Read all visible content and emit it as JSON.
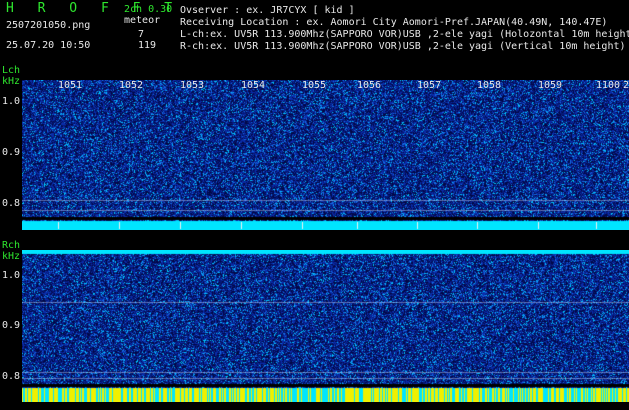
{
  "header": {
    "app_name": "H R O F F T",
    "mode": "2ch 0.30",
    "filename": "2507201050.png",
    "datetime": "25.07.20 10:50",
    "meteor_label": "meteor",
    "meteor_lch": "7",
    "meteor_rch": "119"
  },
  "info": {
    "observer": "Ovserver          : ex. JR7CYX [ kid ]",
    "location": "Receiving Location : ex. Aomori City Aomori-Pref.JAPAN(40.49N, 140.47E)",
    "lch": "L-ch:ex. UV5R 113.900Mhz(SAPPORO VOR)USB ,2-ele yagi (Holozontal 10m height)",
    "rch": "R-ch:ex. UV5R 113.900Mhz(SAPPORO VOR)USB ,2-ele yagi (Vertical 10m height)"
  },
  "lch_panel": {
    "label": "Lch",
    "unit": "kHz",
    "freq_ticks": [
      "1.0",
      "0.9",
      "0.8"
    ]
  },
  "rch_panel": {
    "label": "Rch",
    "unit": "kHz",
    "freq_ticks": [
      "1.0",
      "0.9",
      "0.8"
    ]
  },
  "time_ticks": [
    "1051",
    "1052",
    "1053",
    "1054",
    "1055",
    "1056",
    "1057",
    "1058",
    "1059",
    "1100",
    "2"
  ],
  "colors": {
    "background": "#000000",
    "label_green": "#2ee62e",
    "text_white": "#e8e8e8",
    "waterfall_low": "#0a1a6e",
    "waterfall_high": "#00e5ff",
    "marker_yellow": "#f0f000"
  }
}
